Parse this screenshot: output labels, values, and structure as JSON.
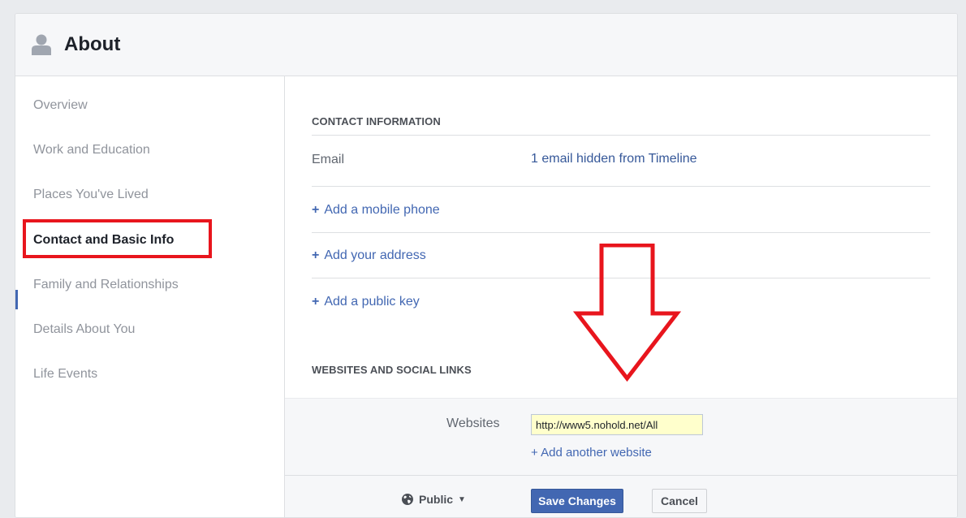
{
  "header": {
    "title": "About",
    "icon": "person-icon"
  },
  "sidebar": {
    "items": [
      {
        "label": "Overview"
      },
      {
        "label": "Work and Education"
      },
      {
        "label": "Places You've Lived"
      },
      {
        "label": "Contact and Basic Info"
      },
      {
        "label": "Family and Relationships"
      },
      {
        "label": "Details About You"
      },
      {
        "label": "Life Events"
      }
    ],
    "active_index": 3
  },
  "contact": {
    "section_title": "CONTACT INFORMATION",
    "email_label": "Email",
    "email_value": "1 email hidden from Timeline",
    "add_mobile": "Add a mobile phone",
    "add_address": "Add your address",
    "add_key": "Add a public key"
  },
  "websites": {
    "section_title": "WEBSITES AND SOCIAL LINKS",
    "label": "Websites",
    "value": "http://www5.nohold.net/All",
    "add_another": "+ Add another website"
  },
  "actions": {
    "privacy_label": "Public",
    "save_label": "Save Changes",
    "cancel_label": "Cancel"
  },
  "colors": {
    "accent": "#4267b2",
    "annotation_red": "#e8151d",
    "input_highlight": "#ffffcc"
  }
}
